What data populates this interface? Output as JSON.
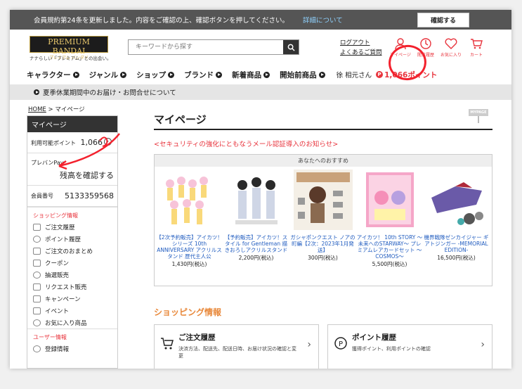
{
  "notice": {
    "text": "会員規約第24条を更新しました。内容をご確認の上、確認ボタンを押してください。",
    "link": "詳細について",
    "confirm": "確認する"
  },
  "header": {
    "logo": "PREMIUM BANDAI",
    "logo_sub": "プレミアム バンダイ",
    "tagline": "ナナらしい「プレミアム」との出会い。",
    "search_placeholder": "キーワードから探す",
    "logout": "ログアウト",
    "faq": "よくあるご質問",
    "icons": [
      {
        "label": "マイページ",
        "icon": "user-icon"
      },
      {
        "label": "閲覧履歴",
        "icon": "history-icon"
      },
      {
        "label": "お気に入り",
        "icon": "heart-icon"
      },
      {
        "label": "カート",
        "icon": "cart-icon"
      }
    ]
  },
  "nav": {
    "items": [
      "キャラクター",
      "ジャンル",
      "ショップ",
      "ブランド",
      "新着商品",
      "開始前商品"
    ],
    "user": "徐 相元さん",
    "points": "1,066ポイント",
    "points_icon": "P"
  },
  "bar": {
    "text": "夏季休業期間中のお届け・お問合せについて"
  },
  "breadcrumb": {
    "home": "HOME",
    "sep": " > ",
    "current": "マイページ"
  },
  "sidebar": {
    "title": "マイページ",
    "points_label": "利用可能ポイント",
    "points_value": "1,066",
    "prepay_label": "プレバンPay",
    "prepay_link": "残高を確認する",
    "member_label": "会員番号",
    "member_no": "5133359568",
    "shopping_title": "ショッピング情報",
    "items": [
      "ご注文履歴",
      "ポイント履歴",
      "ご注文のおまとめ",
      "クーポン",
      "抽選販売",
      "リクエスト販売",
      "キャンペーン",
      "イベント",
      "お気に入り商品"
    ],
    "user_title": "ユーザー情報",
    "user_items": [
      "登録情報"
    ]
  },
  "main": {
    "title": "マイページ",
    "sign": "MYPAGE",
    "security": "<セキュリティの強化にともなうメール認証導入のお知らせ>",
    "rec_title": "あなたへのおすすめ",
    "products": [
      {
        "name": "【2次予約販売】アイカツ！シリーズ 10th ANNIVERSARY アクリルスタンド 歴代主人公",
        "price": "1,430円(税込)",
        "color": "#f7c3d8"
      },
      {
        "name": "【予約販売】アイカツ！スタイル for Gentleman 描きおろしアクリルスタンド",
        "price": "2,200円(税込)",
        "color": "#cfd6e6"
      },
      {
        "name": "ガシャポンクエスト ノアの町編【2次：2023年1月発送】",
        "price": "300円(税込)",
        "color": "#c9a27a"
      },
      {
        "name": "アイカツ！ 10th STORY ～未来へのSTARWAY～ プレミアムレアカードセット ～COSMOS～",
        "price": "5,500円(税込)",
        "color": "#f5a6c8"
      },
      {
        "name": "機界戦隊ゼンカイジャー ギアトジンガー -MEMORIAL EDITION-",
        "price": "16,500円(税込)",
        "color": "#6a5aa8"
      }
    ],
    "shopping_title": "ショッピング情報",
    "cards": [
      {
        "title": "ご注文履歴",
        "desc": "決済方法、配送先、配送日時、お届け状況の確認と変更"
      },
      {
        "title": "ポイント履歴",
        "desc": "獲得ポイント、利用ポイントの確認"
      }
    ]
  }
}
